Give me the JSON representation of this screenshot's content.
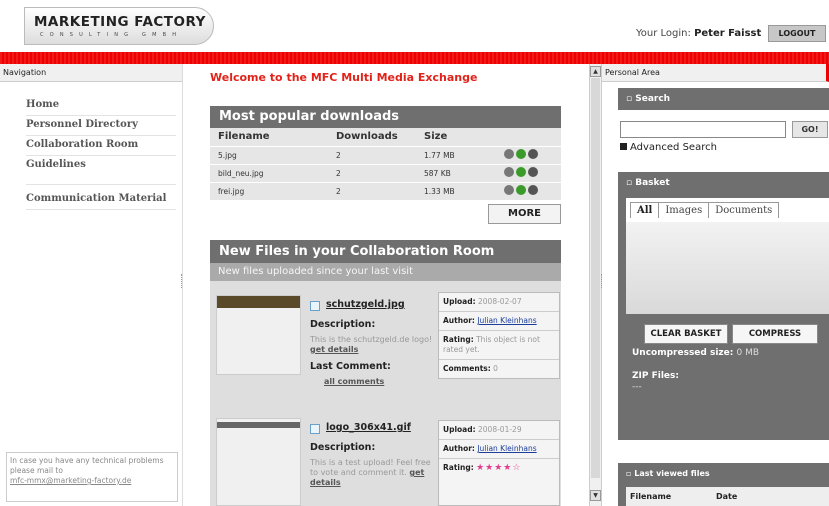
{
  "header": {
    "logo_title": "MARKETING FACTORY",
    "logo_subtitle": "CONSULTING GMBH",
    "login_label": "Your Login:",
    "login_user": "Peter Faisst",
    "logout_label": "LOGOUT"
  },
  "nav": {
    "bar_label": "Navigation",
    "items": [
      "Home",
      "Personnel Directory",
      "Collaboration Room",
      "Guidelines",
      "Communication Material"
    ],
    "footer_text": "In case you have any technical problems please mail to",
    "footer_email": "mfc-mmx@marketing-factory.de"
  },
  "main": {
    "welcome": "Welcome to the MFC Multi Media Exchange",
    "popular": {
      "title": "Most popular downloads",
      "columns": [
        "Filename",
        "Downloads",
        "Size"
      ],
      "rows": [
        {
          "filename": "5.jpg",
          "downloads": "2",
          "size": "1.77 MB"
        },
        {
          "filename": "bild_neu.jpg",
          "downloads": "2",
          "size": "587 KB"
        },
        {
          "filename": "frei.jpg",
          "downloads": "2",
          "size": "1.33 MB"
        }
      ],
      "more_label": "MORE"
    },
    "newfiles": {
      "title": "New Files in your Collaboration Room",
      "subtitle": "New files uploaded since your last visit",
      "entries": [
        {
          "filename": "schutzgeld.jpg",
          "description_label": "Description:",
          "description": "This is the schutzgeld.de logo!",
          "details_link": "get details",
          "last_comment_label": "Last Comment:",
          "all_comments_link": "all comments",
          "upload_label": "Upload:",
          "upload_date": "2008-02-07",
          "author_label": "Author:",
          "author": "Julian Kleinhans",
          "rating_label": "Rating:",
          "rating_text": "This object is not rated yet.",
          "comments_label": "Comments:",
          "comments_count": "0"
        },
        {
          "filename": "logo_306x41.gif",
          "description_label": "Description:",
          "description": "This is a test upload! Feel free to vote and comment it.",
          "details_link": "get details",
          "upload_label": "Upload:",
          "upload_date": "2008-01-29",
          "author_label": "Author:",
          "author": "Julian Kleinhans",
          "rating_label": "Rating:",
          "rating_stars": 4,
          "rating_max": 5
        }
      ]
    }
  },
  "right": {
    "bar_label": "Personal Area",
    "search": {
      "title": "Search",
      "input_value": "",
      "go_label": "GO!",
      "advanced_label": "Advanced Search"
    },
    "basket": {
      "title": "Basket",
      "tabs": [
        "All",
        "Images",
        "Documents"
      ],
      "active_tab": "All",
      "clear_label": "CLEAR BASKET",
      "compress_label": "COMPRESS",
      "uncompressed_label": "Uncompressed size:",
      "uncompressed_value": "0 MB",
      "zip_label": "ZIP Files:",
      "zip_value": "---"
    },
    "last_viewed": {
      "title": "Last viewed files",
      "columns": [
        "Filename",
        "Date"
      ]
    }
  },
  "colors": {
    "accent_red": "#e2231a",
    "panel_gray": "#6f6f6f",
    "rating_pink": "#e33c8c"
  }
}
